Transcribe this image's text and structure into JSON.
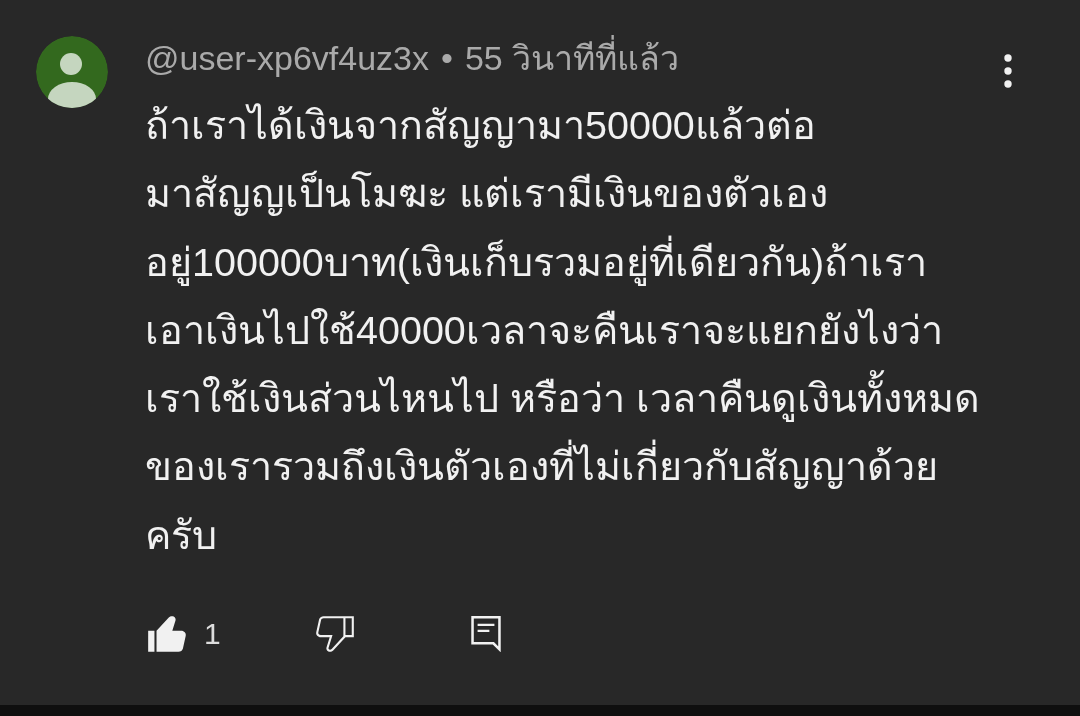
{
  "comment": {
    "author": "@user-xp6vf4uz3x",
    "separator": "•",
    "time": "55 วินาทีที่แล้ว",
    "text": "ถ้าเราได้เงินจากสัญญามา50000แล้วต่อ\nมาสัญญเป็นโมฆะ แต่เรามีเงินของตัวเอง\nอยู่100000บาท(เงินเก็บรวมอยู่ที่เดียวกัน)ถ้าเรา\nเอาเงินไปใช้40000เวลาจะคืนเราจะแยกยังไงว่า\nเราใช้เงินส่วนไหนไป หรือว่า เวลาคืนดูเงินทั้งหมด\nของเรารวมถึงเงินตัวเองที่ไม่เกี่ยวกับสัญญาด้วย\nครับ",
    "like_count": "1",
    "liked": true,
    "disliked": false
  }
}
